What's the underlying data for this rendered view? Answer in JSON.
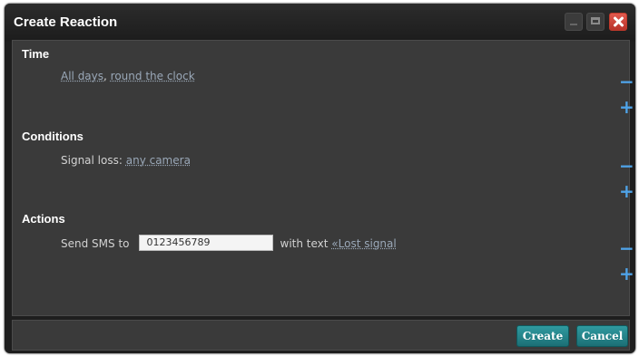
{
  "window": {
    "title": "Create Reaction"
  },
  "sections": {
    "time": {
      "title": "Time",
      "days": "All days",
      "separator": ",",
      "hours": "round the clock"
    },
    "conditions": {
      "title": "Conditions",
      "prefix": "Signal loss:",
      "camera": "any camera"
    },
    "actions": {
      "title": "Actions",
      "prefix": "Send SMS to",
      "phone_value": "0123456789",
      "with_text": "with text",
      "message": "«Lost signal"
    }
  },
  "controls": {
    "remove": "−",
    "add": "+"
  },
  "buttons": {
    "create": "Create",
    "cancel": "Cancel"
  },
  "colors": {
    "accent_plus_minus": "#4fa3e8",
    "button": "#2f9aa0",
    "close": "#d9473d",
    "panel": "#3a3a3a",
    "frame": "#1e1e1e"
  }
}
